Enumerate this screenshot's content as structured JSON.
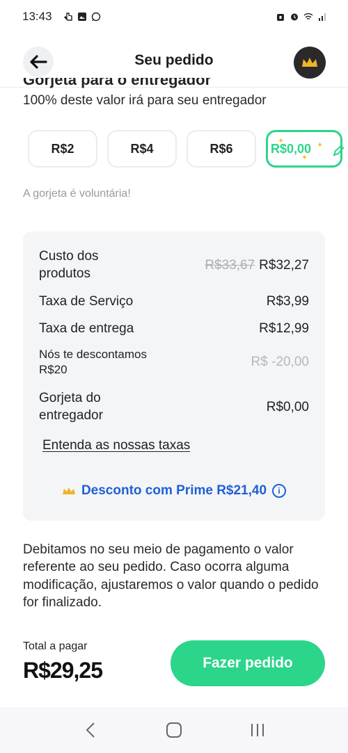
{
  "status_bar": {
    "time": "13:43",
    "left_icons": [
      "tap-icon",
      "image-icon",
      "whatsapp-icon"
    ],
    "right_icons": [
      "lock-icon",
      "alarm-icon",
      "wifi-icon",
      "signal-icon"
    ]
  },
  "header": {
    "title": "Seu pedido",
    "back_icon": "arrow-left-icon",
    "prime_icon": "crown-icon"
  },
  "tip": {
    "subtitle": "100% deste valor irá para seu entregador",
    "options": [
      "R$2",
      "R$4",
      "R$6",
      "R$0,00"
    ],
    "selected_index": 3,
    "note": "A gorjeta é voluntária!"
  },
  "summary": {
    "rows": [
      {
        "label": "Custo dos produtos",
        "old_value": "R$33,67",
        "value": "R$32,27"
      },
      {
        "label": "Taxa de Serviço",
        "value": "R$3,99"
      },
      {
        "label": "Taxa de entrega",
        "value": "R$12,99"
      },
      {
        "label": "Nós te descontamos R$20",
        "value": "R$ -20,00"
      },
      {
        "label": "Gorjeta do entregador",
        "value": "R$0,00"
      }
    ],
    "fees_link": "Entenda as nossas taxas",
    "prime_discount": "Desconto com Prime R$21,40"
  },
  "disclaimer": "Debitamos no seu meio de pagamento o valor referente ao seu pedido. Caso ocorra alguma modificação, ajustaremos o valor quando o pedido for finalizado.",
  "footer": {
    "total_label": "Total a pagar",
    "total_value": "R$29,25",
    "cta_label": "Fazer pedido"
  },
  "colors": {
    "accent_green": "#2bd58a",
    "prime_blue": "#1f5fd6",
    "crown_gold": "#f0b429"
  }
}
